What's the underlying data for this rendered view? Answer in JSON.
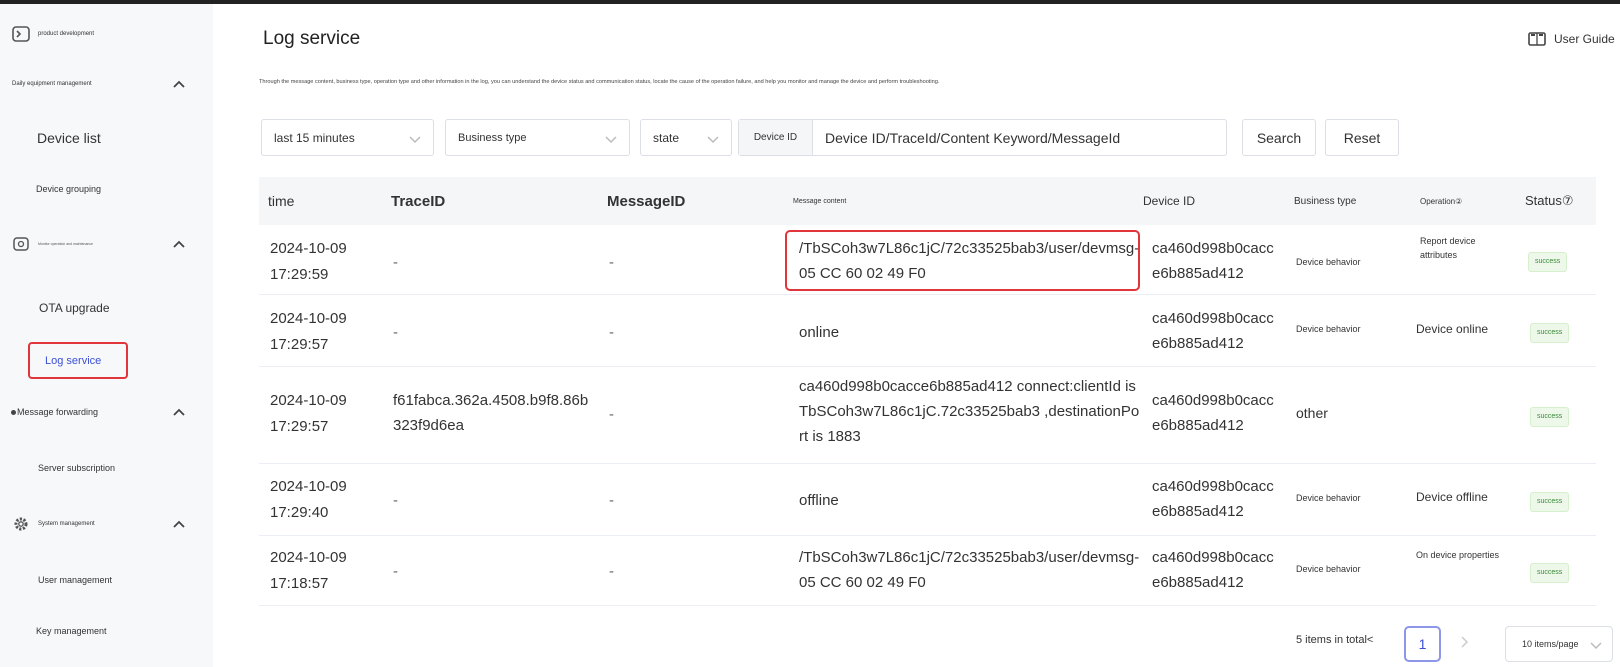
{
  "sidebar": {
    "product_development": "product development",
    "groups": [
      {
        "label": "Daily equipment management",
        "items": [
          "Device list",
          "Device grouping"
        ]
      },
      {
        "label": "Monitor operation and maintenance",
        "items": [
          "OTA upgrade",
          "Log service"
        ]
      },
      {
        "label": "Message forwarding",
        "items": [
          "Server subscription"
        ]
      },
      {
        "label": "System management",
        "items": [
          "User management",
          "Key management"
        ]
      }
    ],
    "active_item": "Log service"
  },
  "header": {
    "title": "Log service",
    "user_guide": "User Guide",
    "description": "Through the message content, business type, operation type and other information in the log, you can understand the device status and communication status, locate the cause of the operation failure, and help you monitor and manage the device and perform troubleshooting."
  },
  "filters": {
    "time_range": "last 15 minutes",
    "business_type": "Business type",
    "state": "state",
    "device_id_label": "Device ID",
    "search_placeholder": "Device ID/TraceId/Content Keyword/MessageId",
    "search_button": "Search",
    "reset_button": "Reset"
  },
  "table": {
    "headers": {
      "time": "time",
      "trace_id": "TraceID",
      "message_id": "MessageID",
      "message_content": "Message content",
      "device_id": "Device ID",
      "business_type": "Business type",
      "operation": "Operation②",
      "status": "Status⑦"
    },
    "rows": [
      {
        "date": "2024-10-09",
        "time": "17:29:59",
        "trace_id": "-",
        "message_id": "-",
        "message": "/TbSCoh3w7L86c1jC/72c33525bab3/user/devmsg-05 CC 60 02 49 F0",
        "device_id": "ca460d998b0cacce6b885ad412",
        "business_type": "Device behavior",
        "operation": "Report device attributes",
        "status": "success"
      },
      {
        "date": "2024-10-09",
        "time": "17:29:57",
        "trace_id": "-",
        "message_id": "-",
        "message": "online",
        "device_id": "ca460d998b0cacce6b885ad412",
        "business_type": "Device behavior",
        "operation": "Device online",
        "status": "success"
      },
      {
        "date": "2024-10-09",
        "time": "17:29:57",
        "trace_id": "f61fabca.362a.4508.b9f8.86b323f9d6ea",
        "message_id": "-",
        "message": "ca460d998b0cacce6b885ad412 connect:clientId is TbSCoh3w7L86c1jC.72c33525bab3 ,destinationPort is 1883",
        "device_id": "ca460d998b0cacce6b885ad412",
        "business_type": "other",
        "operation": "",
        "status": "success"
      },
      {
        "date": "2024-10-09",
        "time": "17:29:40",
        "trace_id": "-",
        "message_id": "-",
        "message": "offline",
        "device_id": "ca460d998b0cacce6b885ad412",
        "business_type": "Device behavior",
        "operation": "Device offline",
        "status": "success"
      },
      {
        "date": "2024-10-09",
        "time": "17:18:57",
        "trace_id": "-",
        "message_id": "-",
        "message": "/TbSCoh3w7L86c1jC/72c33525bab3/user/devmsg-05 CC 60 02 49 F0",
        "device_id": "ca460d998b0cacce6b885ad412",
        "business_type": "Device behavior",
        "operation": "On device properties",
        "status": "success"
      }
    ]
  },
  "pagination": {
    "total": "5 items in total<",
    "current_page": "1",
    "page_size": "10 items/page"
  },
  "colors": {
    "accent": "#3b4fd6",
    "highlight": "#e0353b",
    "success_text": "#3a8a3a",
    "success_bg": "#eef8ea"
  }
}
